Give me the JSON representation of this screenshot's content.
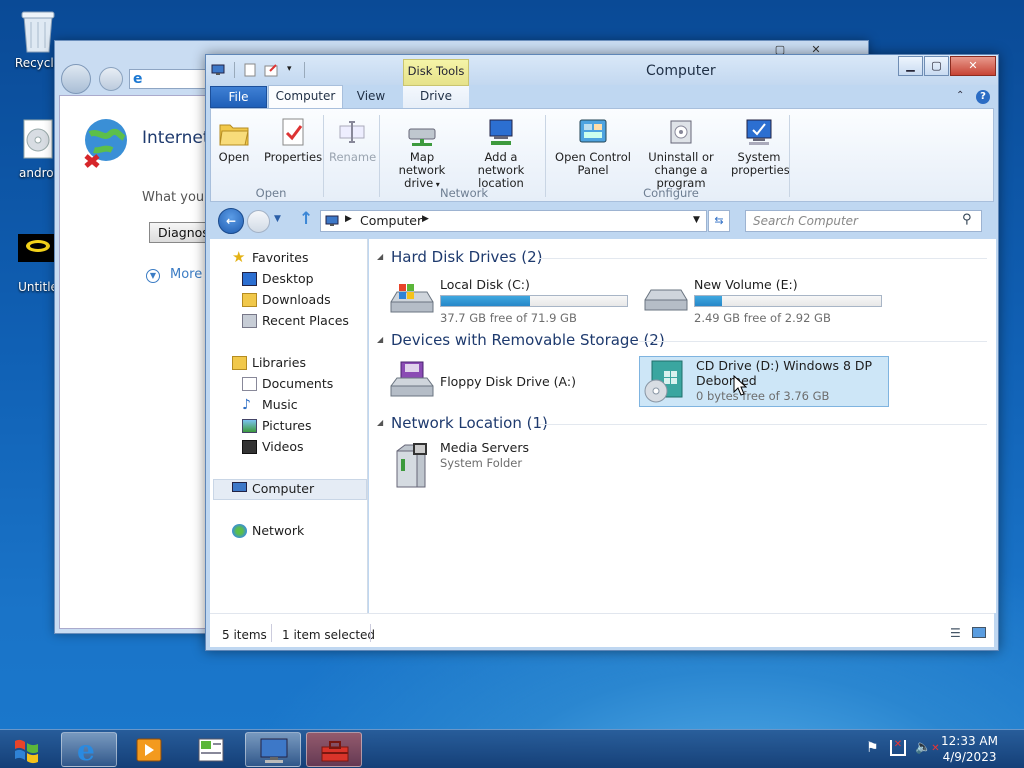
{
  "desktop": {
    "icons": [
      {
        "label": "Recycle"
      },
      {
        "label": "androi"
      },
      {
        "label": "Untitle"
      }
    ]
  },
  "ie": {
    "heading": "Internet",
    "text": "What you",
    "button": "Diagnos",
    "more": "More"
  },
  "explorer": {
    "title": "Computer",
    "context_tab_group": "Disk Tools",
    "tabs": [
      "File",
      "Computer",
      "View",
      "Drive"
    ],
    "ribbon": {
      "open": "Open",
      "properties": "Properties",
      "rename": "Rename",
      "map_drive": "Map network",
      "map_drive_2": "drive",
      "add_location": "Add a network",
      "add_location_2": "location",
      "control_panel": "Open Control",
      "control_panel_2": "Panel",
      "uninstall": "Uninstall or",
      "uninstall_2": "change a program",
      "system_props": "System",
      "system_props_2": "properties",
      "groups": {
        "open": "Open",
        "network": "Network",
        "configure": "Configure"
      }
    },
    "address": {
      "path": "Computer"
    },
    "search": {
      "placeholder": "Search Computer"
    },
    "nav": {
      "favorites": "Favorites",
      "desktop": "Desktop",
      "downloads": "Downloads",
      "recent": "Recent Places",
      "libraries": "Libraries",
      "documents": "Documents",
      "music": "Music",
      "pictures": "Pictures",
      "videos": "Videos",
      "computer": "Computer",
      "network": "Network"
    },
    "groups": {
      "hdd": "Hard Disk Drives (2)",
      "removable": "Devices with Removable Storage (2)",
      "netloc": "Network Location (1)"
    },
    "drives": {
      "c": {
        "name": "Local Disk (C:)",
        "free": "37.7 GB free of 71.9 GB",
        "used_fraction": 0.476
      },
      "e": {
        "name": "New Volume (E:)",
        "free": "2.49 GB free of 2.92 GB",
        "used_fraction": 0.147
      },
      "a": {
        "name": "Floppy Disk Drive (A:)"
      },
      "d": {
        "name": "CD Drive (D:) Windows 8 DP",
        "name_2": "Debomed",
        "free": "0 bytes free of 3.76 GB"
      },
      "media": {
        "name": "Media Servers",
        "sub": "System Folder"
      }
    },
    "status": {
      "items": "5 items",
      "selected": "1 item selected"
    }
  },
  "taskbar": {
    "time": "12:33 AM",
    "date": "4/9/2023"
  },
  "colors": {
    "accent": "#2687c9",
    "selection": "#cde6f7",
    "ribbon_tab_file": "#2b6cc4"
  }
}
